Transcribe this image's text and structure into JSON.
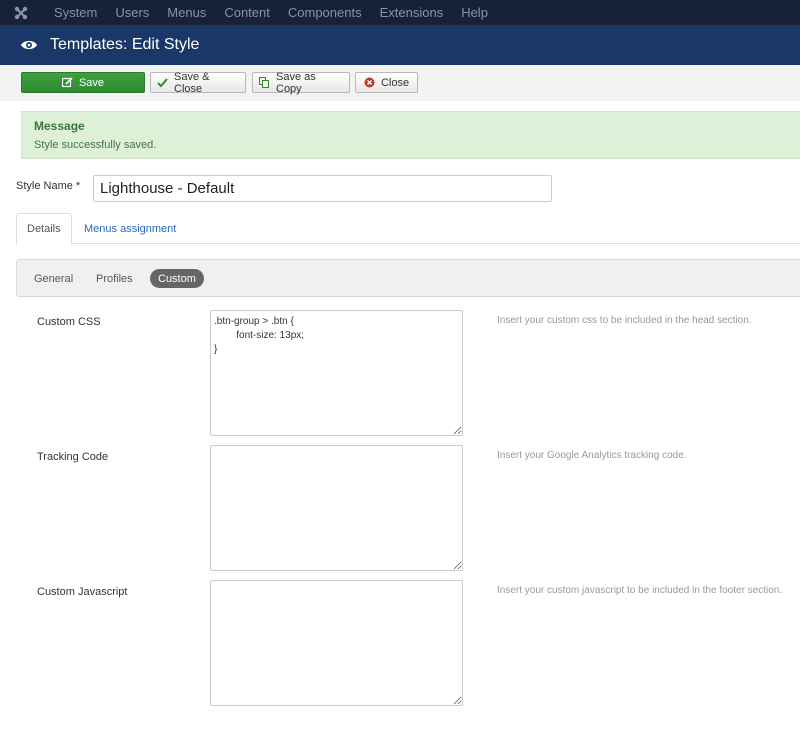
{
  "topnav": {
    "logo_icon": "joomla-logo-icon",
    "items": [
      "System",
      "Users",
      "Menus",
      "Content",
      "Components",
      "Extensions",
      "Help"
    ]
  },
  "titlebar": {
    "icon": "eye-icon",
    "title": "Templates: Edit Style"
  },
  "toolbar": {
    "save_label": "Save",
    "save_close_label": "Save & Close",
    "save_copy_label": "Save as Copy",
    "close_label": "Close"
  },
  "message": {
    "title": "Message",
    "text": "Style successfully saved."
  },
  "style_name": {
    "label": "Style Name *",
    "value": "Lighthouse - Default"
  },
  "tabs": [
    {
      "label": "Details",
      "active": true
    },
    {
      "label": "Menus assignment",
      "active": false
    }
  ],
  "subtabs": [
    {
      "label": "General",
      "active": false
    },
    {
      "label": "Profiles",
      "active": false
    },
    {
      "label": "Custom",
      "active": true
    }
  ],
  "fields": {
    "custom_css": {
      "label": "Custom CSS",
      "value": ".btn-group > .btn {\n        font-size: 13px;\n}",
      "help": "Insert your custom css to be included in the head section."
    },
    "tracking_code": {
      "label": "Tracking Code",
      "value": "",
      "help": "Insert your Google Analytics tracking code."
    },
    "custom_js": {
      "label": "Custom Javascript",
      "value": "",
      "help": "Insert your custom javascript to be included in the footer section."
    }
  },
  "colors": {
    "topnav_bg": "#17223a",
    "titlebar_bg": "#1a3867",
    "save_green": "#3a9a3a",
    "message_bg": "#dff0d8"
  }
}
